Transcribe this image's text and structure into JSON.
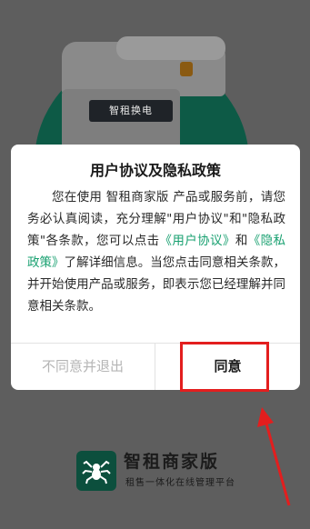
{
  "splash": {
    "device_label": "智租换电",
    "brand_name": "智租商家版",
    "brand_tagline": "租售一体化在线管理平台"
  },
  "dialog": {
    "title": "用户协议及隐私政策",
    "body_part1": "您在使用 智租商家版 产品或服务前，请您务必认真阅读，充分理解\"用户协议\"和\"隐私政策\"各条款，您可以点击",
    "link_user_agreement": "《用户协议》",
    "body_and": "和",
    "link_privacy_policy": "《隐私政策》",
    "body_part2": "了解详细信息。当您点击同意相关条款，并开始使用产品或服务，即表示您已经理解并同意相关条款。",
    "decline_label": "不同意并退出",
    "agree_label": "同意"
  },
  "colors": {
    "overlay": "#5e5e5e",
    "brand_green": "#0d5a46",
    "link_green": "#18a070",
    "annotation_red": "#e31e1e"
  }
}
